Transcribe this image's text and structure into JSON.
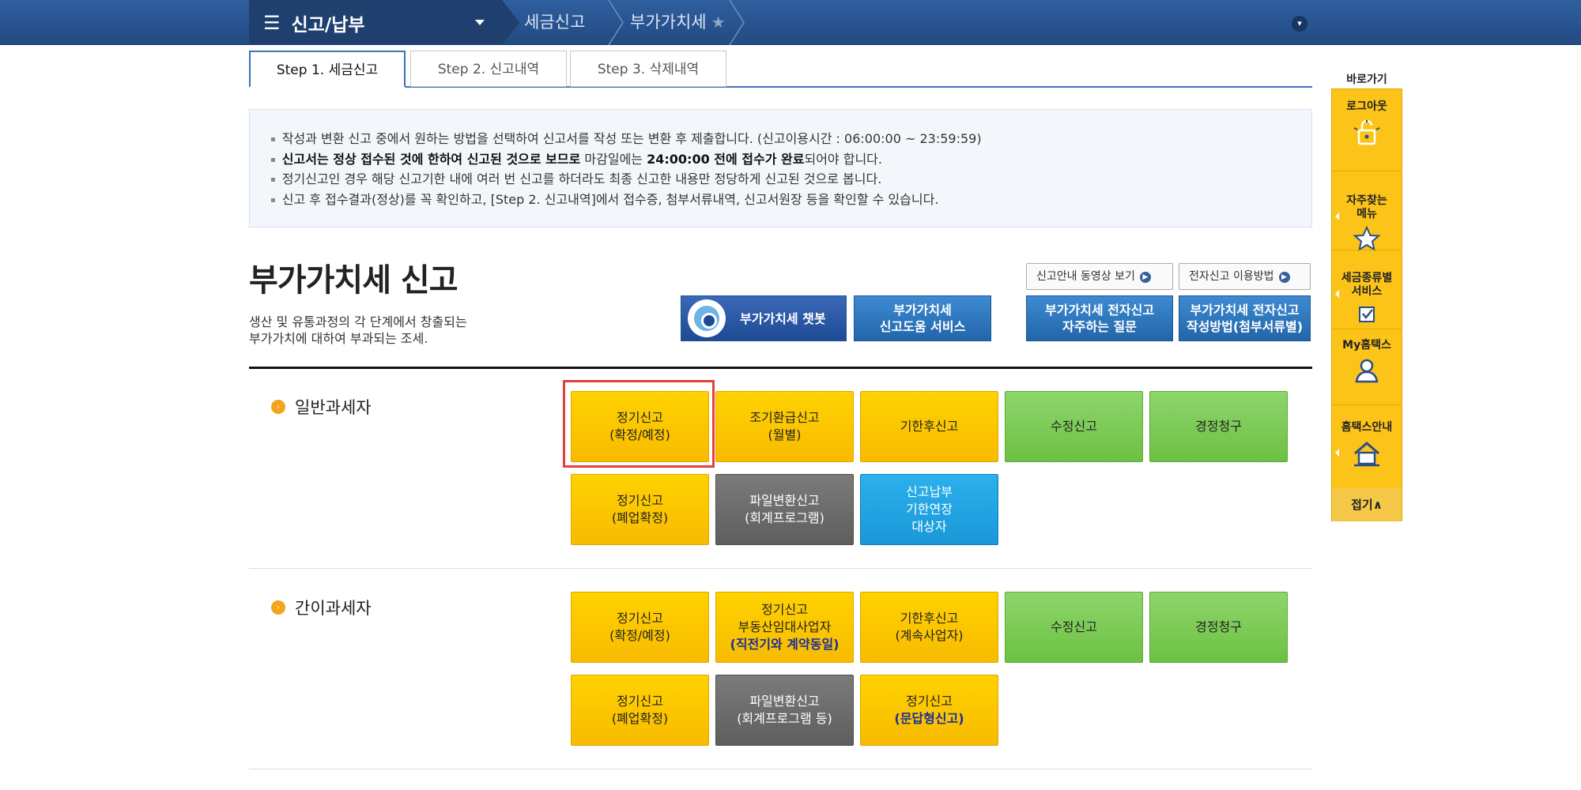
{
  "nav": {
    "menu_title": "신고/납부",
    "crumbs": [
      "세금신고",
      "부가가치세"
    ]
  },
  "tabs": [
    "Step 1. 세금신고",
    "Step 2. 신고내역",
    "Step 3. 삭제내역"
  ],
  "notice": {
    "line1": "작성과 변환 신고 중에서 원하는 방법을 선택하여 신고서를 작성 또는 변환 후 제출합니다. (신고이용시간 : 06:00:00 ~ 23:59:59)",
    "line2_bold1": "신고서는 정상 접수된 것에 한하여 신고된 것으로 보므로",
    "line2_mid": " 마감일에는 ",
    "line2_bold2": "24:00:00 전에 접수가 완료",
    "line2_end": "되어야 합니다.",
    "line3": "정기신고인 경우 해당 신고기한 내에 여러 번 신고를 하더라도 최종 신고한 내용만 정당하게 신고된 것으로 봅니다.",
    "line4": "신고 후 접수결과(정상)를 꼭 확인하고, [Step 2. 신고내역]에서 접수증, 첨부서류내역, 신고서원장 등을 확인할 수 있습니다."
  },
  "page": {
    "title": "부가가치세 신고",
    "desc_line1": "생산 및 유통과정의 각 단계에서 창출되는",
    "desc_line2": "부가가치에 대하여 부과되는 조세."
  },
  "links": {
    "video": "신고안내 동영상 보기",
    "howto": "전자신고 이용방법"
  },
  "blue_buttons": {
    "chatbot": "부가가치세 챗봇",
    "help": "부가가치세\n신고도움 서비스",
    "faq": "부가가치세 전자신고\n자주하는 질문",
    "guide": "부가가치세 전자신고\n작성방법(첨부서류별)"
  },
  "general": {
    "label": "일반과세자",
    "regular": "정기신고\n(확정/예정)",
    "early_refund": "조기환급신고\n(월별)",
    "late": "기한후신고",
    "amend": "수정신고",
    "claim": "경정청구",
    "closure": "정기신고\n(폐업확정)",
    "file_convert": "파일변환신고\n(회계프로그램)",
    "extension": "신고납부\n기한연장\n대상자"
  },
  "simplified": {
    "label": "간이과세자",
    "regular": "정기신고\n(확정/예정)",
    "realestate_top": "정기신고\n부동산임대사업자",
    "realestate_bottom": "(직전기와 계약동일)",
    "late": "기한후신고\n(계속사업자)",
    "amend": "수정신고",
    "claim": "경정청구",
    "closure": "정기신고\n(폐업확정)",
    "file_convert": "파일변환신고\n(회계프로그램 등)",
    "qa_top": "정기신고",
    "qa_bottom": "(문답형신고)"
  },
  "quick_menu": {
    "title": "바로가기",
    "logout": "로그아웃",
    "favorites": "자주찾는\n메뉴",
    "tax_services": "세금종류별\n서비스",
    "my_hometax": "My홈택스",
    "hometax_guide": "홈택스안내",
    "close": "접기∧"
  }
}
